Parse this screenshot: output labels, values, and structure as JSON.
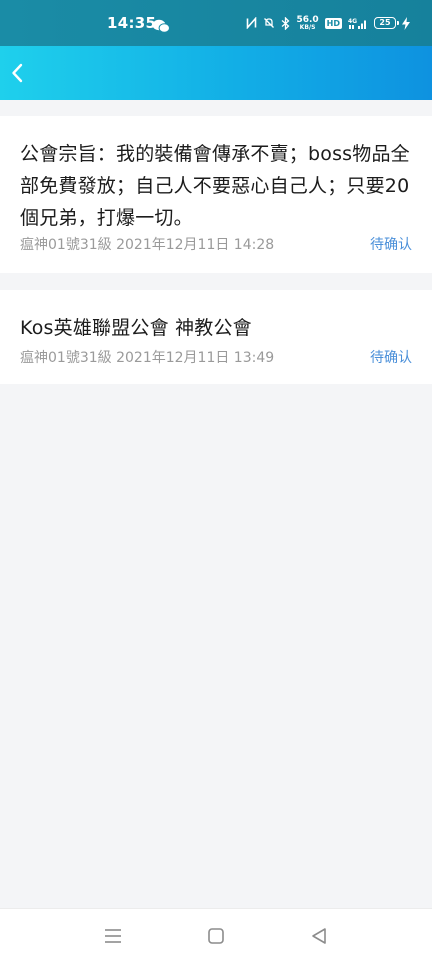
{
  "status_bar": {
    "time": "14:35",
    "net_speed_value": "56.0",
    "net_speed_unit": "KB/S",
    "hd_label": "HD",
    "signal_label": "4G",
    "battery_level": "25"
  },
  "items": [
    {
      "title": "公會宗旨：我的裝備會傳承不賣；boss物品全部免費發放；自己人不要惡心自己人；只要20個兄弟，打爆一切。",
      "author": "瘟神01號31級",
      "timestamp": "2021年12月11日 14:28",
      "status": "待确认"
    },
    {
      "title": "Kos英雄聯盟公會 神教公會",
      "author": "瘟神01號31級",
      "timestamp": "2021年12月11日 13:49",
      "status": "待确认"
    }
  ],
  "colors": {
    "header_start": "#1fd0ec",
    "header_end": "#0e92e0",
    "status_bar_bg": "#1a8ca6",
    "link": "#4a8fd9",
    "meta_text": "#9a9a9a"
  },
  "icons": {
    "back": "chevron-left-icon",
    "wechat": "wechat-icon",
    "nav_menu": "menu-icon",
    "nav_home": "square-home-icon",
    "nav_back": "triangle-back-icon"
  }
}
